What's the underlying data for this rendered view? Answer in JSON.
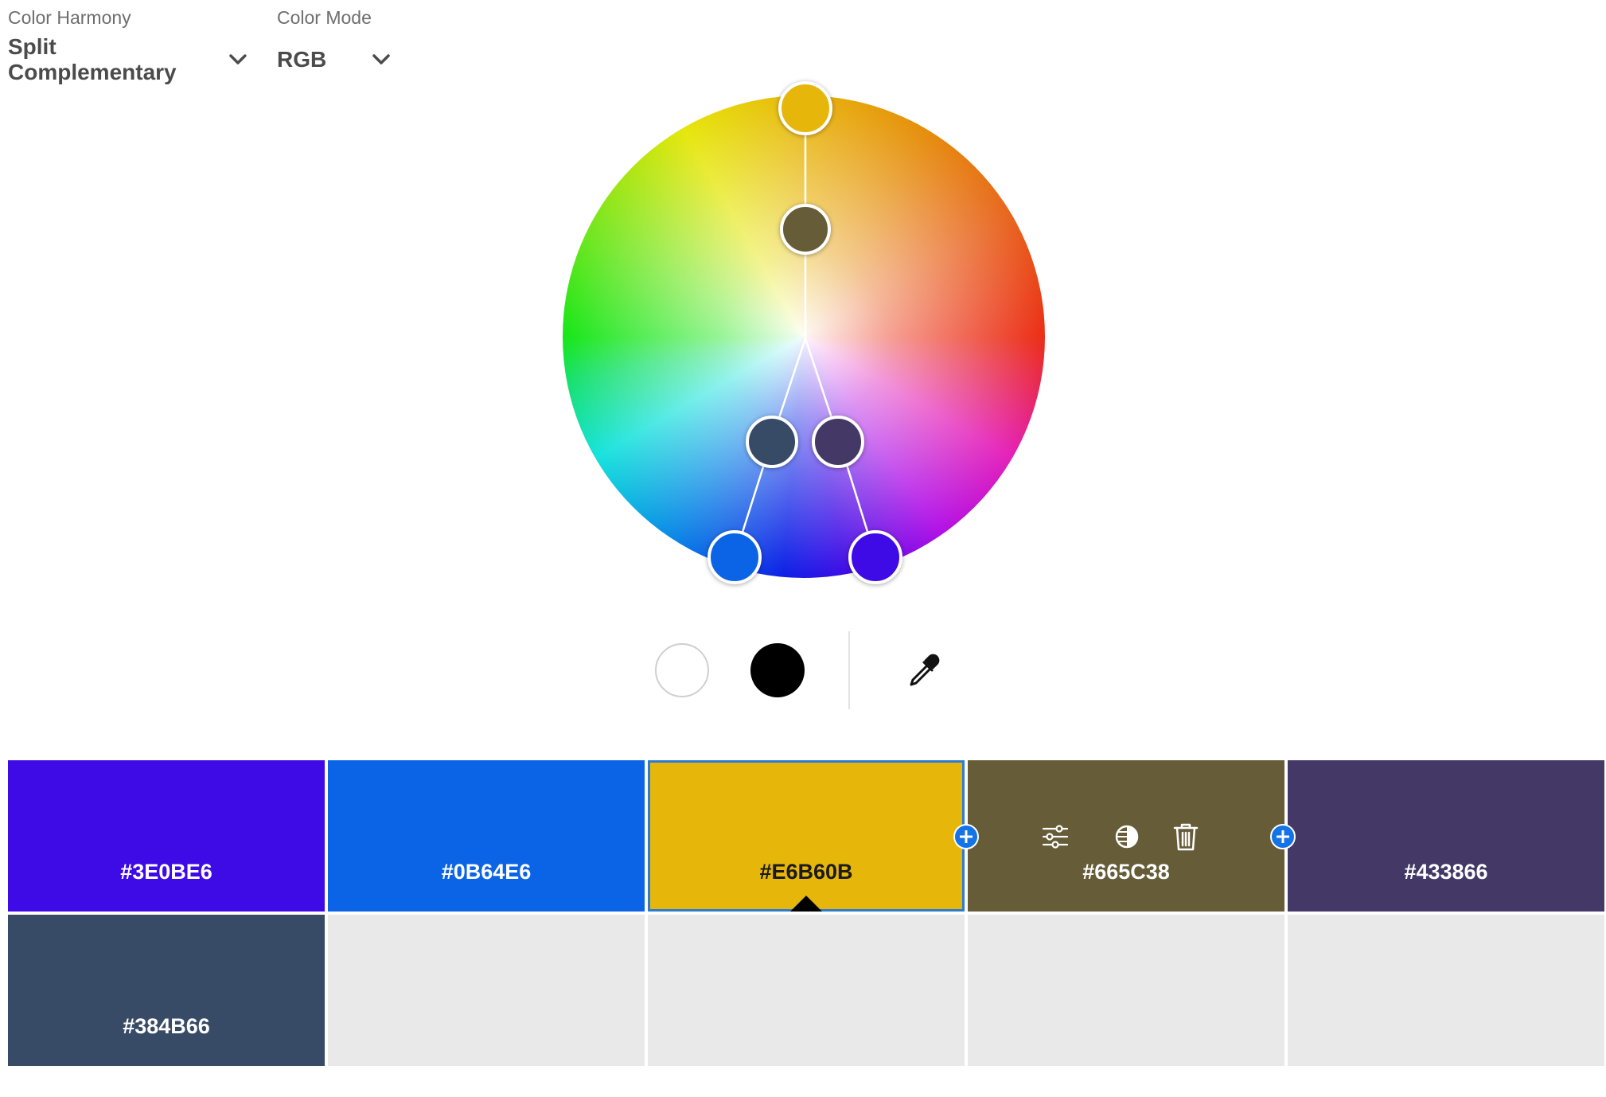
{
  "controls": {
    "harmony": {
      "label": "Color Harmony",
      "value": "Split Complementary"
    },
    "mode": {
      "label": "Color Mode",
      "value": "RGB"
    }
  },
  "wheel": {
    "handles": [
      {
        "name": "base",
        "color": "#E6B60B"
      },
      {
        "name": "inner-base",
        "color": "#665C38"
      },
      {
        "name": "inner-left",
        "color": "#384B66"
      },
      {
        "name": "inner-right",
        "color": "#433866"
      },
      {
        "name": "outer-left",
        "color": "#0B64E6"
      },
      {
        "name": "outer-right",
        "color": "#3E0BE6"
      }
    ]
  },
  "tools": {
    "white": "#FFFFFF",
    "black": "#000000",
    "eyedropper_icon": "eyedropper-icon"
  },
  "palette": {
    "swatches": [
      {
        "hex": "#3E0BE6",
        "color": "#3E0BE6",
        "text_color": "#FFFFFF"
      },
      {
        "hex": "#0B64E6",
        "color": "#0B64E6",
        "text_color": "#FFFFFF"
      },
      {
        "hex": "#E6B60B",
        "color": "#E6B60B",
        "text_color": "#1A1A1A",
        "selected": true
      },
      {
        "hex": "#665C38",
        "color": "#665C38",
        "text_color": "#FFFFFF",
        "hovered": true
      },
      {
        "hex": "#433866",
        "color": "#433866",
        "text_color": "#FFFFFF"
      },
      {
        "hex": "#384B66",
        "color": "#384B66",
        "text_color": "#FFFFFF"
      }
    ],
    "swatch_tools": [
      "sliders-icon",
      "contrast-icon",
      "trash-icon"
    ],
    "accent": "#1473E6"
  }
}
